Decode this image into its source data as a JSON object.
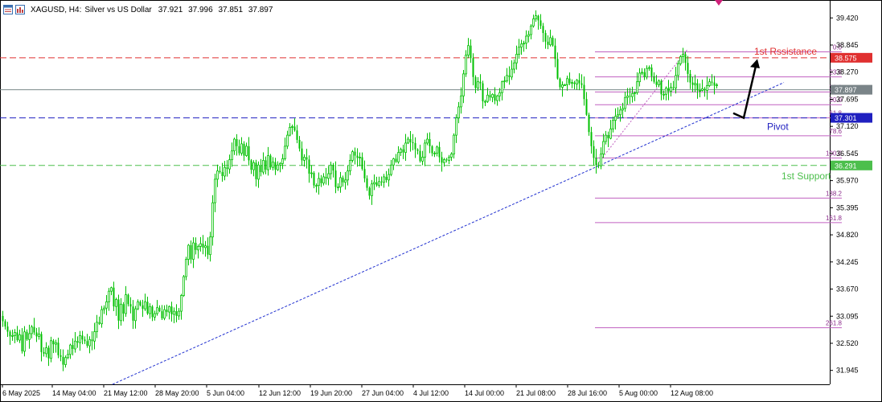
{
  "header": {
    "symbol": "XAGUSD, H4:",
    "description": "Silver vs US Dollar",
    "open": "37.921",
    "high": "37.996",
    "low": "37.851",
    "close": "37.897"
  },
  "annotations": {
    "resistance": "1st Rssistance",
    "pivot": "Pivot",
    "support": "1st Support"
  },
  "colors": {
    "candle": "#00c000",
    "resistance": "#e03030",
    "pivot": "#2020c0",
    "support": "#4cbf4c",
    "fib": "#c060c0",
    "trendline": "#2030d0"
  },
  "chart_data": {
    "type": "candlestick",
    "symbol": "XAGUSD",
    "timeframe": "H4",
    "ylim": [
      31.65,
      39.8
    ],
    "yticks": [
      "39.420",
      "38.845",
      "38.270",
      "37.695",
      "37.120",
      "36.545",
      "35.970",
      "35.395",
      "34.820",
      "34.245",
      "33.670",
      "33.095",
      "32.520",
      "31.945"
    ],
    "xticks": [
      "6 May 2025",
      "14 May 04:00",
      "21 May 12:00",
      "28 May 20:00",
      "5 Jun 04:00",
      "12 Jun 12:00",
      "19 Jun 20:00",
      "27 Jun 04:00",
      "4 Jul 12:00",
      "14 Jul 00:00",
      "21 Jul 08:00",
      "28 Jul 16:00",
      "5 Aug 00:00",
      "12 Aug 08:00"
    ],
    "price_path": [
      [
        0,
        33.1
      ],
      [
        8,
        32.8
      ],
      [
        14,
        32.6
      ],
      [
        17,
        32.85
      ],
      [
        20,
        32.55
      ],
      [
        24,
        32.7
      ],
      [
        27,
        32.35
      ],
      [
        31,
        32.9
      ],
      [
        34,
        32.45
      ],
      [
        38,
        33.0
      ],
      [
        41,
        32.6
      ],
      [
        43,
        32.9
      ],
      [
        46,
        32.55
      ],
      [
        49,
        32.8
      ],
      [
        52,
        32.1
      ],
      [
        56,
        32.5
      ],
      [
        60,
        32.2
      ],
      [
        64,
        32.7
      ],
      [
        67,
        32.4
      ],
      [
        70,
        32.6
      ],
      [
        73,
        32.1
      ],
      [
        76,
        32.3
      ],
      [
        79,
        31.95
      ],
      [
        82,
        32.35
      ],
      [
        85,
        32.25
      ],
      [
        88,
        32.6
      ],
      [
        91,
        32.3
      ],
      [
        94,
        32.7
      ],
      [
        97,
        32.45
      ],
      [
        100,
        32.8
      ],
      [
        103,
        32.5
      ],
      [
        106,
        32.6
      ],
      [
        109,
        32.4
      ],
      [
        112,
        32.7
      ],
      [
        115,
        32.5
      ],
      [
        118,
        32.9
      ],
      [
        121,
        33.0
      ],
      [
        124,
        32.9
      ],
      [
        127,
        33.4
      ],
      [
        130,
        33.2
      ],
      [
        134,
        33.6
      ],
      [
        138,
        33.7
      ],
      [
        141,
        33.3
      ],
      [
        144,
        33.45
      ],
      [
        147,
        33.0
      ],
      [
        150,
        33.35
      ],
      [
        153,
        33.15
      ],
      [
        156,
        33.55
      ],
      [
        159,
        33.35
      ],
      [
        162,
        33.3
      ],
      [
        165,
        33.0
      ],
      [
        168,
        33.25
      ],
      [
        172,
        33.45
      ],
      [
        176,
        33.2
      ],
      [
        180,
        33.4
      ],
      [
        183,
        33.15
      ],
      [
        186,
        33.3
      ],
      [
        190,
        33.0
      ],
      [
        194,
        33.3
      ],
      [
        198,
        33.2
      ],
      [
        202,
        33.0
      ],
      [
        205,
        33.35
      ],
      [
        208,
        33.1
      ],
      [
        211,
        33.4
      ],
      [
        214,
        33.0
      ],
      [
        217,
        33.3
      ],
      [
        220,
        33.0
      ],
      [
        224,
        33.4
      ],
      [
        227,
        33.8
      ],
      [
        230,
        34.2
      ],
      [
        234,
        34.6
      ],
      [
        237,
        34.3
      ],
      [
        240,
        34.65
      ],
      [
        244,
        34.45
      ],
      [
        248,
        34.7
      ],
      [
        251,
        34.5
      ],
      [
        254,
        34.65
      ],
      [
        258,
        34.4
      ],
      [
        262,
        34.9
      ],
      [
        265,
        35.8
      ],
      [
        268,
        36.1
      ],
      [
        272,
        36.25
      ],
      [
        275,
        35.95
      ],
      [
        278,
        36.3
      ],
      [
        281,
        36.15
      ],
      [
        284,
        36.35
      ],
      [
        288,
        36.6
      ],
      [
        291,
        36.85
      ],
      [
        294,
        36.7
      ],
      [
        297,
        36.55
      ],
      [
        300,
        36.75
      ],
      [
        303,
        36.5
      ],
      [
        306,
        36.7
      ],
      [
        309,
        36.4
      ],
      [
        312,
        36.2
      ],
      [
        315,
        36.35
      ],
      [
        318,
        36.0
      ],
      [
        321,
        36.3
      ],
      [
        324,
        36.15
      ],
      [
        327,
        36.4
      ],
      [
        330,
        36.2
      ],
      [
        333,
        36.5
      ],
      [
        336,
        36.25
      ],
      [
        340,
        36.4
      ],
      [
        343,
        36.1
      ],
      [
        346,
        36.4
      ],
      [
        349,
        36.3
      ],
      [
        352,
        36.5
      ],
      [
        355,
        36.8
      ],
      [
        358,
        37.0
      ],
      [
        361,
        37.15
      ],
      [
        364,
        37.1
      ],
      [
        367,
        37.0
      ],
      [
        370,
        36.75
      ],
      [
        373,
        36.6
      ],
      [
        376,
        36.3
      ],
      [
        379,
        36.55
      ],
      [
        382,
        36.35
      ],
      [
        385,
        36.0
      ],
      [
        388,
        36.2
      ],
      [
        391,
        35.7
      ],
      [
        394,
        35.95
      ],
      [
        397,
        36.05
      ],
      [
        400,
        35.85
      ],
      [
        403,
        36.15
      ],
      [
        406,
        35.95
      ],
      [
        409,
        36.2
      ],
      [
        412,
        36.35
      ],
      [
        415,
        36.1
      ],
      [
        418,
        35.7
      ],
      [
        421,
        35.9
      ],
      [
        424,
        36.1
      ],
      [
        427,
        35.85
      ],
      [
        430,
        36.05
      ],
      [
        434,
        36.3
      ],
      [
        437,
        36.6
      ],
      [
        440,
        36.55
      ],
      [
        443,
        36.4
      ],
      [
        446,
        36.55
      ],
      [
        449,
        36.3
      ],
      [
        452,
        36.05
      ],
      [
        455,
        35.95
      ],
      [
        458,
        35.55
      ],
      [
        461,
        35.85
      ],
      [
        464,
        36.0
      ],
      [
        467,
        35.8
      ],
      [
        470,
        36.0
      ],
      [
        473,
        35.85
      ],
      [
        476,
        36.1
      ],
      [
        479,
        35.95
      ],
      [
        482,
        36.05
      ],
      [
        485,
        36.2
      ],
      [
        488,
        36.5
      ],
      [
        491,
        36.3
      ],
      [
        494,
        36.5
      ],
      [
        497,
        36.7
      ],
      [
        500,
        36.5
      ],
      [
        503,
        36.7
      ],
      [
        506,
        36.9
      ],
      [
        509,
        36.75
      ],
      [
        512,
        36.85
      ],
      [
        515,
        36.6
      ],
      [
        518,
        36.7
      ],
      [
        521,
        36.4
      ],
      [
        524,
        36.35
      ],
      [
        527,
        36.7
      ],
      [
        530,
        36.9
      ],
      [
        533,
        36.75
      ],
      [
        536,
        36.6
      ],
      [
        539,
        36.45
      ],
      [
        542,
        36.75
      ],
      [
        545,
        36.55
      ],
      [
        548,
        36.3
      ],
      [
        551,
        36.45
      ],
      [
        554,
        36.35
      ],
      [
        557,
        36.5
      ],
      [
        560,
        36.4
      ],
      [
        563,
        36.8
      ],
      [
        566,
        37.2
      ],
      [
        569,
        37.5
      ],
      [
        572,
        37.6
      ],
      [
        575,
        38.1
      ],
      [
        578,
        38.5
      ],
      [
        581,
        38.9
      ],
      [
        584,
        38.7
      ],
      [
        587,
        38.3
      ],
      [
        590,
        37.9
      ],
      [
        593,
        38.0
      ],
      [
        596,
        38.2
      ],
      [
        599,
        37.7
      ],
      [
        602,
        37.55
      ],
      [
        605,
        37.85
      ],
      [
        608,
        37.65
      ],
      [
        611,
        37.9
      ],
      [
        614,
        37.6
      ],
      [
        617,
        37.8
      ],
      [
        620,
        37.7
      ],
      [
        623,
        38.1
      ],
      [
        626,
        38.0
      ],
      [
        629,
        38.25
      ],
      [
        632,
        38.1
      ],
      [
        635,
        38.3
      ],
      [
        638,
        38.4
      ],
      [
        641,
        38.6
      ],
      [
        644,
        38.75
      ],
      [
        647,
        38.9
      ],
      [
        650,
        38.8
      ],
      [
        653,
        39.05
      ],
      [
        656,
        39.0
      ],
      [
        659,
        39.2
      ],
      [
        662,
        39.35
      ],
      [
        665,
        39.5
      ],
      [
        668,
        39.4
      ],
      [
        671,
        39.3
      ],
      [
        674,
        39.15
      ],
      [
        677,
        39.0
      ],
      [
        680,
        38.75
      ],
      [
        683,
        39.05
      ],
      [
        686,
        38.9
      ],
      [
        689,
        38.7
      ],
      [
        692,
        38.25
      ],
      [
        695,
        37.9
      ],
      [
        698,
        38.05
      ],
      [
        701,
        37.9
      ],
      [
        704,
        38.2
      ],
      [
        707,
        38.0
      ],
      [
        710,
        38.1
      ],
      [
        713,
        37.95
      ],
      [
        716,
        38.15
      ],
      [
        719,
        38.0
      ],
      [
        722,
        38.1
      ],
      [
        725,
        37.8
      ],
      [
        728,
        37.5
      ],
      [
        731,
        37.1
      ],
      [
        734,
        36.8
      ],
      [
        737,
        36.5
      ],
      [
        740,
        36.35
      ],
      [
        743,
        36.2
      ],
      [
        746,
        36.45
      ],
      [
        749,
        36.7
      ],
      [
        752,
        37.0
      ],
      [
        755,
        36.8
      ],
      [
        758,
        37.0
      ],
      [
        761,
        37.2
      ],
      [
        764,
        37.35
      ],
      [
        767,
        37.3
      ],
      [
        770,
        37.5
      ],
      [
        773,
        37.4
      ],
      [
        776,
        37.7
      ],
      [
        779,
        37.8
      ],
      [
        782,
        37.7
      ],
      [
        785,
        37.85
      ],
      [
        788,
        37.75
      ],
      [
        791,
        38.0
      ],
      [
        794,
        38.2
      ],
      [
        797,
        38.35
      ],
      [
        800,
        38.1
      ],
      [
        803,
        38.3
      ],
      [
        806,
        38.45
      ],
      [
        809,
        38.2
      ],
      [
        812,
        38.15
      ],
      [
        815,
        37.9
      ],
      [
        818,
        38.2
      ],
      [
        821,
        37.85
      ],
      [
        824,
        37.7
      ],
      [
        827,
        38.0
      ],
      [
        830,
        37.8
      ],
      [
        833,
        38.0
      ],
      [
        836,
        37.85
      ],
      [
        839,
        38.1
      ],
      [
        842,
        38.4
      ],
      [
        845,
        38.55
      ],
      [
        848,
        38.7
      ],
      [
        851,
        38.55
      ],
      [
        854,
        38.3
      ],
      [
        857,
        38.1
      ],
      [
        860,
        37.95
      ],
      [
        863,
        38.1
      ],
      [
        866,
        37.9
      ],
      [
        869,
        37.85
      ],
      [
        872,
        37.95
      ],
      [
        875,
        37.85
      ],
      [
        878,
        37.95
      ],
      [
        881,
        38.05
      ],
      [
        884,
        38.1
      ],
      [
        887,
        37.95
      ],
      [
        890,
        38.05
      ],
      [
        893,
        37.9
      ]
    ],
    "levels": [
      {
        "name": "resistance",
        "price": 38.575,
        "label": "38.575"
      },
      {
        "name": "current",
        "price": 37.897,
        "label": "37.897"
      },
      {
        "name": "pivot",
        "price": 37.301,
        "label": "37.301"
      },
      {
        "name": "support",
        "price": 36.291,
        "label": "36.291"
      }
    ],
    "fibonacci": {
      "levels": [
        {
          "ratio": "0.0",
          "price": 38.7
        },
        {
          "ratio": "23.6",
          "price": 38.17
        },
        {
          "ratio": "38.2",
          "price": 37.85
        },
        {
          "ratio": "50.0",
          "price": 37.58
        },
        {
          "ratio": "61.8",
          "price": 37.3
        },
        {
          "ratio": "78.6",
          "price": 36.92
        },
        {
          "ratio": "100.0",
          "price": 36.45
        },
        {
          "ratio": "138.2",
          "price": 35.6
        },
        {
          "ratio": "161.8",
          "price": 35.08
        },
        {
          "ratio": "261.8",
          "price": 32.85
        }
      ]
    },
    "trendline": {
      "from_price": 31.65,
      "to_price": 38.05
    }
  }
}
